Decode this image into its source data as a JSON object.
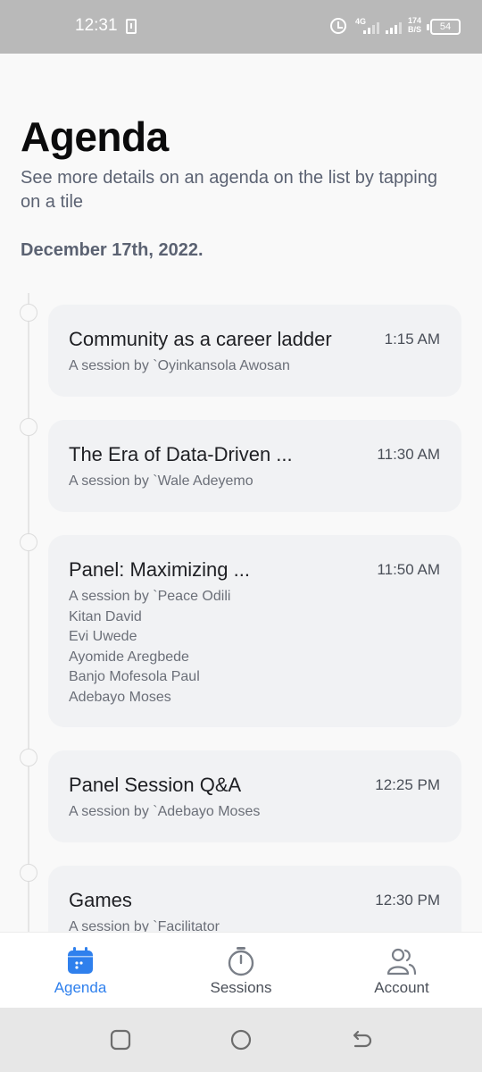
{
  "status_bar": {
    "time": "12:31",
    "network_type": "4G",
    "speed_value": "174",
    "speed_unit": "B/S",
    "battery": "54"
  },
  "page": {
    "title": "Agenda",
    "subtitle": "See more details on an agenda on the list by tapping on a tile",
    "date": "December 17th, 2022."
  },
  "sessions": [
    {
      "title": "Community as a career ladder",
      "time": "1:15 AM",
      "speaker": "A  session by `Oyinkansola Awosan"
    },
    {
      "title": "The Era of Data-Driven ...",
      "time": "11:30 AM",
      "speaker": "A  session by `Wale Adeyemo"
    },
    {
      "title": "Panel: Maximizing ...",
      "time": "11:50 AM",
      "speaker": "A  session by `Peace Odili",
      "extra_speakers": [
        "Kitan David",
        "Evi Uwede",
        "Ayomide Aregbede",
        "Banjo Mofesola Paul",
        "Adebayo Moses"
      ]
    },
    {
      "title": "Panel Session Q&A",
      "time": "12:25 PM",
      "speaker": "A  session by `Adebayo Moses"
    },
    {
      "title": "Games",
      "time": "12:30 PM",
      "speaker": "A  session by `Facilitator"
    }
  ],
  "bottom_nav": {
    "items": [
      {
        "label": "Agenda",
        "icon": "calendar-icon",
        "active": true
      },
      {
        "label": "Sessions",
        "icon": "stopwatch-icon",
        "active": false
      },
      {
        "label": "Account",
        "icon": "users-icon",
        "active": false
      }
    ]
  },
  "colors": {
    "accent": "#2f80ed",
    "card_bg": "#f1f2f4",
    "subtitle": "#5b6272"
  }
}
